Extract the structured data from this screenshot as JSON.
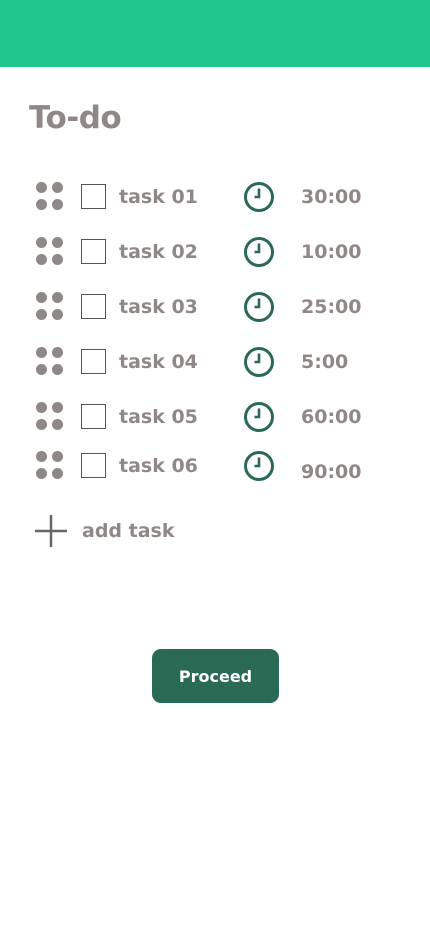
{
  "page": {
    "title": "To-do"
  },
  "tasks": [
    {
      "name": "task 01",
      "duration": "30:00"
    },
    {
      "name": "task 02",
      "duration": "10:00"
    },
    {
      "name": "task 03",
      "duration": "25:00"
    },
    {
      "name": "task 04",
      "duration": "5:00"
    },
    {
      "name": "task 05",
      "duration": "60:00"
    },
    {
      "name": "task 06",
      "duration": "90:00"
    }
  ],
  "add_task": {
    "label": "add task",
    "icon": "plus-icon"
  },
  "proceed": {
    "label": "Proceed"
  },
  "icons": {
    "drag": "drag-handle-icon",
    "clock": "clock-icon"
  },
  "colors": {
    "header": "#20c68e",
    "accent": "#2a6a55",
    "text": "#8f8887"
  }
}
